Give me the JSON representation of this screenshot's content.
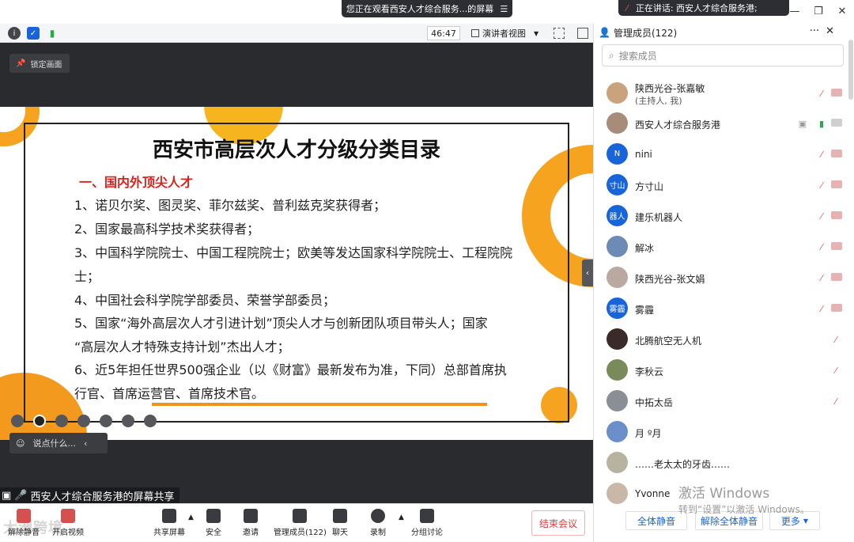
{
  "banner": {
    "text": "您正在观看西安人才综合服务...的屏幕",
    "menu_icon": "menu-icon"
  },
  "speaking": {
    "text": "正在讲话: 西安人才综合服务港;"
  },
  "toolbar": {
    "timer": "46:47",
    "view_label": "演讲者视图"
  },
  "stage": {
    "lock_label": "锁定画面",
    "chat_placeholder": "说点什么...",
    "share_label": "西安人才综合服务港的屏幕共享"
  },
  "slide": {
    "title": "西安市高层次人才分级分类目录",
    "subtitle": "一、国内外顶尖人才",
    "lines": [
      "1、诺贝尔奖、图灵奖、菲尔兹奖、普利兹克奖获得者；",
      "2、国家最高科学技术奖获得者；",
      "3、中国科学院院士、中国工程院院士；欧美等发达国家科学院院士、工程院院",
      "士；",
      "4、中国社会科学院学部委员、荣誉学部委员；",
      "5、国家“海外高层次人才引进计划”顶尖人才与创新团队项目带头人；国家",
      "“高层次人才特殊支持计划”杰出人才；",
      "6、近5年担任世界500强企业（以《财富》最新发布为准，下同）总部首席执",
      "行官、首席运营官、首席技术官。"
    ]
  },
  "bottom": {
    "items": [
      "解除静音",
      "开启视频",
      "共享屏幕",
      "安全",
      "邀请",
      "管理成员(122)",
      "聊天",
      "录制",
      "分组讨论"
    ],
    "end_label": "结束会议",
    "watermark": "大洲跨境"
  },
  "panel": {
    "title": "管理成员(122)",
    "search_placeholder": "搜索成员",
    "members": [
      {
        "name": "陕西光谷-张嘉敏",
        "role": "(主持人, 我)",
        "avatar": "",
        "color": "#c9a27e"
      },
      {
        "name": "西安人才综合服务港",
        "role": "",
        "avatar": "",
        "color": "#a88c7a"
      },
      {
        "name": "nini",
        "role": "",
        "avatar": "N",
        "color": "#1a64d9"
      },
      {
        "name": "方寸山",
        "role": "",
        "avatar": "寸山",
        "color": "#1a64d9"
      },
      {
        "name": "建乐机器人",
        "role": "",
        "avatar": "器人",
        "color": "#1a64d9"
      },
      {
        "name": "解冰",
        "role": "",
        "avatar": "",
        "color": "#6c8bb5"
      },
      {
        "name": "陕西光谷-张文娟",
        "role": "",
        "avatar": "",
        "color": "#b9a9a0"
      },
      {
        "name": "雾霾",
        "role": "",
        "avatar": "雾霾",
        "color": "#1a64d9"
      },
      {
        "name": "北腾航空无人机",
        "role": "",
        "avatar": "",
        "color": "#3b2a2a"
      },
      {
        "name": "李秋云",
        "role": "",
        "avatar": "",
        "color": "#7a8a5a"
      },
      {
        "name": "中拓太岳",
        "role": "",
        "avatar": "",
        "color": "#8a8f96"
      },
      {
        "name": "月 º月",
        "role": "",
        "avatar": "",
        "color": "#6a8fc9"
      },
      {
        "name": "……老太太的牙齿……",
        "role": "",
        "avatar": "",
        "color": "#b8b2a0"
      },
      {
        "name": "Yvonne",
        "role": "",
        "avatar": "",
        "color": "#c9b8a8"
      }
    ],
    "footer": {
      "mute_all": "全体静音",
      "unmute_all": "解除全体静音",
      "more": "更多"
    }
  },
  "activation": {
    "line1": "激活 Windows",
    "line2": "转到“设置”以激活 Windows。"
  }
}
